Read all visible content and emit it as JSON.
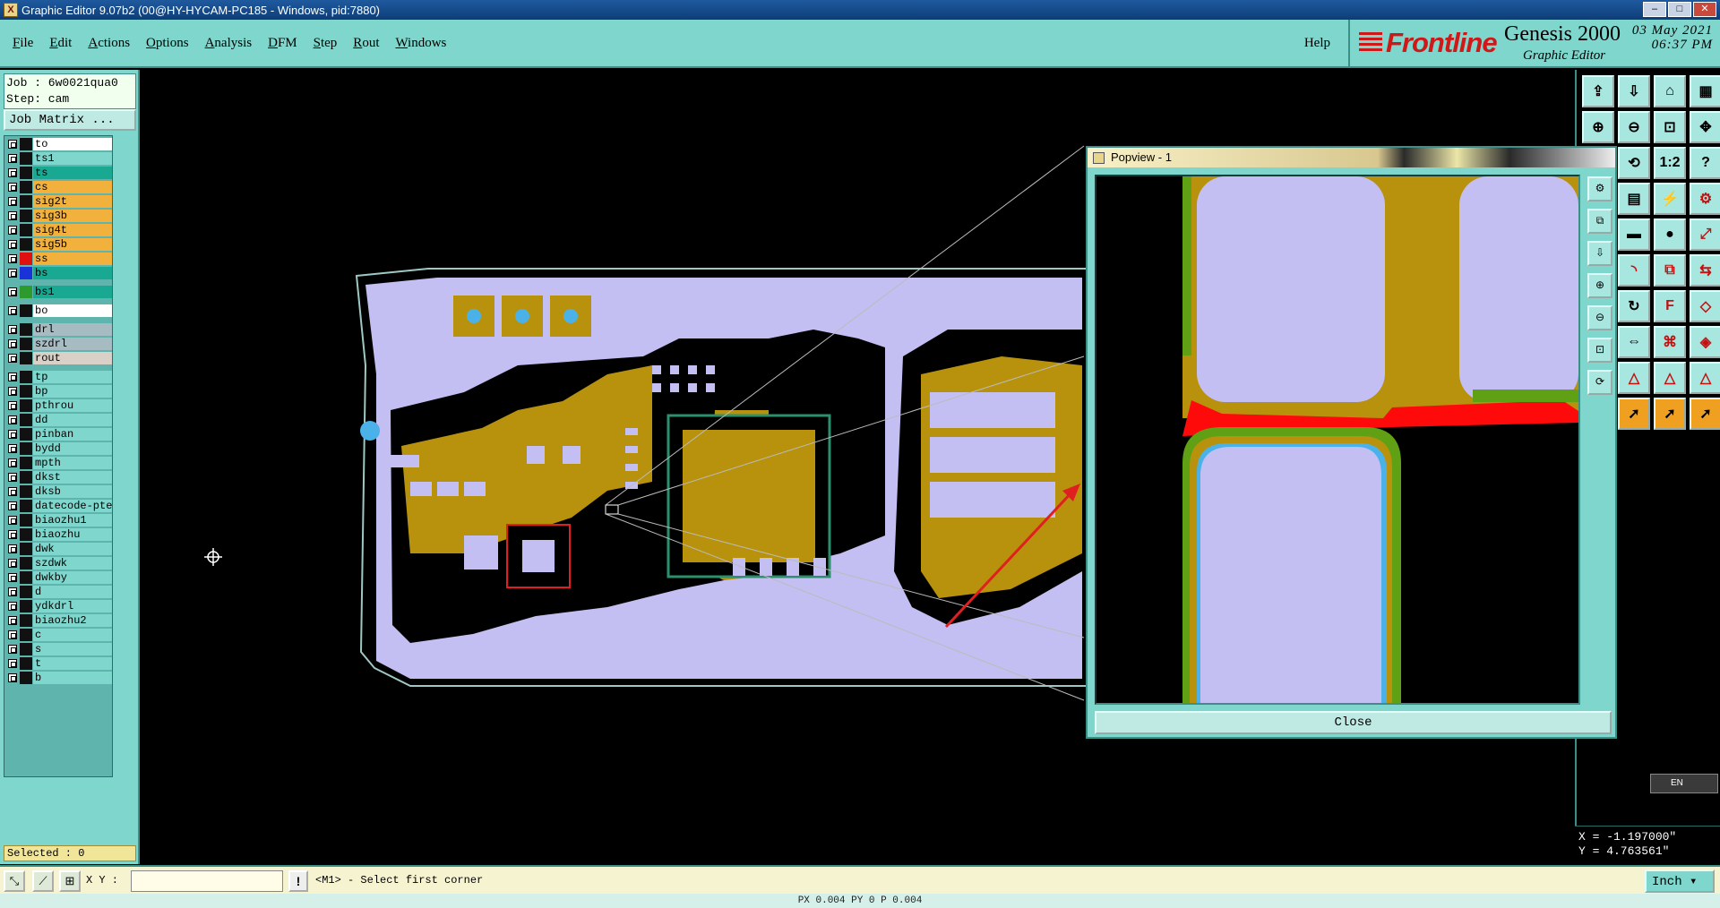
{
  "window": {
    "title": "Graphic Editor 9.07b2 (00@HY-HYCAM-PC185 - Windows, pid:7880)",
    "minimize": "–",
    "maximize": "□",
    "close": "✕"
  },
  "menu": {
    "items": [
      "File",
      "Edit",
      "Actions",
      "Options",
      "Analysis",
      "DFM",
      "Step",
      "Rout",
      "Windows"
    ],
    "help": "Help"
  },
  "brand": {
    "logo": "Frontline",
    "product": "Genesis 2000",
    "subtitle": "Graphic Editor",
    "date": "03 May 2021",
    "time": "06:37 PM"
  },
  "job": {
    "job_label": "Job : 6w0021qua0",
    "step_label": "Step: cam",
    "matrix_button": "Job Matrix ..."
  },
  "layers": [
    {
      "name": "to",
      "bg": "#ffffff",
      "swatch": "#111111"
    },
    {
      "name": "ts1",
      "bg": "#7ed6cc",
      "swatch": "#111111"
    },
    {
      "name": "ts",
      "bg": "#19a892",
      "swatch": "#111111"
    },
    {
      "name": "cs",
      "bg": "#f2b13c",
      "swatch": "#111111"
    },
    {
      "name": "sig2t",
      "bg": "#f2b13c",
      "swatch": "#111111"
    },
    {
      "name": "sig3b",
      "bg": "#f2b13c",
      "swatch": "#111111"
    },
    {
      "name": "sig4t",
      "bg": "#f2b13c",
      "swatch": "#111111"
    },
    {
      "name": "sig5b",
      "bg": "#f2b13c",
      "swatch": "#111111"
    },
    {
      "name": "ss",
      "bg": "#f2b13c",
      "swatch": "#e01010"
    },
    {
      "name": "bs",
      "bg": "#19a892",
      "swatch": "#1a33d8"
    },
    {
      "name": "bs1",
      "bg": "#19a892",
      "swatch": "#2d9a2d"
    },
    {
      "name": "bo",
      "bg": "#ffffff",
      "swatch": "#111111"
    },
    {
      "name": "drl",
      "bg": "#a7bcc2",
      "swatch": "#111111"
    },
    {
      "name": "szdrl",
      "bg": "#a7bcc2",
      "swatch": "#111111"
    },
    {
      "name": "rout",
      "bg": "#d9d0c8",
      "swatch": "#111111"
    },
    {
      "name": "tp",
      "bg": "#7ed6cc",
      "swatch": "#111111"
    },
    {
      "name": "bp",
      "bg": "#7ed6cc",
      "swatch": "#111111"
    },
    {
      "name": "pthrou",
      "bg": "#7ed6cc",
      "swatch": "#111111"
    },
    {
      "name": "dd",
      "bg": "#7ed6cc",
      "swatch": "#111111"
    },
    {
      "name": "pinban",
      "bg": "#7ed6cc",
      "swatch": "#111111"
    },
    {
      "name": "bydd",
      "bg": "#7ed6cc",
      "swatch": "#111111"
    },
    {
      "name": "mpth",
      "bg": "#7ed6cc",
      "swatch": "#111111"
    },
    {
      "name": "dkst",
      "bg": "#7ed6cc",
      "swatch": "#111111"
    },
    {
      "name": "dksb",
      "bg": "#7ed6cc",
      "swatch": "#111111"
    },
    {
      "name": "datecode-pte",
      "bg": "#7ed6cc",
      "swatch": "#111111"
    },
    {
      "name": "biaozhu1",
      "bg": "#7ed6cc",
      "swatch": "#111111"
    },
    {
      "name": "biaozhu",
      "bg": "#7ed6cc",
      "swatch": "#111111"
    },
    {
      "name": "dwk",
      "bg": "#7ed6cc",
      "swatch": "#111111"
    },
    {
      "name": "szdwk",
      "bg": "#7ed6cc",
      "swatch": "#111111"
    },
    {
      "name": "dwkby",
      "bg": "#7ed6cc",
      "swatch": "#111111"
    },
    {
      "name": "d",
      "bg": "#7ed6cc",
      "swatch": "#111111"
    },
    {
      "name": "ydkdrl",
      "bg": "#7ed6cc",
      "swatch": "#111111"
    },
    {
      "name": "biaozhu2",
      "bg": "#7ed6cc",
      "swatch": "#111111"
    },
    {
      "name": "c",
      "bg": "#7ed6cc",
      "swatch": "#111111"
    },
    {
      "name": "s",
      "bg": "#7ed6cc",
      "swatch": "#111111"
    },
    {
      "name": "t",
      "bg": "#7ed6cc",
      "swatch": "#111111"
    },
    {
      "name": "b",
      "bg": "#7ed6cc",
      "swatch": "#111111"
    }
  ],
  "selected": "Selected : 0",
  "popview": {
    "title": "Popview - 1",
    "close_label": "Close"
  },
  "coords": {
    "x": "X = -1.197000\"",
    "y": "Y = 4.763561\""
  },
  "bottom": {
    "xy_label": "X Y :",
    "xy_value": "",
    "prompt": "<M1> - Select first corner",
    "units": "Inch",
    "status_line": "PX 0.004 PY 0 P 0.004"
  },
  "ime": "EN",
  "colors": {
    "panel": "#7ed6cc",
    "copper": "#b8920d",
    "pad": "#c4bff2",
    "mask_red": "#ff0a0a",
    "mask_green": "#5fa015",
    "outline": "#9ec8c4",
    "pointer_arrow": "#e02020"
  }
}
